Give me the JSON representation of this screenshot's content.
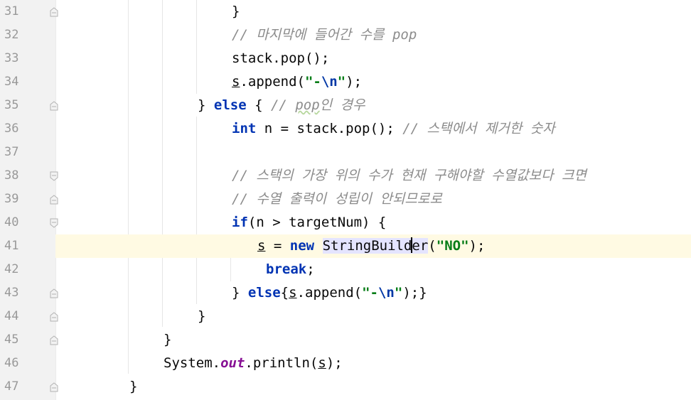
{
  "editor": {
    "current_line": "41",
    "lines": [
      {
        "num": "31",
        "code": "}"
      },
      {
        "num": "32",
        "comment": "// 마지막에 들어간 수를 pop"
      },
      {
        "num": "33",
        "code": "stack.pop();"
      },
      {
        "num": "34",
        "var": "s",
        "code": ".append(",
        "str_open": "\"-",
        "esc": "\\n",
        "str_close": "\"",
        "tail": ");"
      },
      {
        "num": "35",
        "brace": "} ",
        "kw": "else",
        "code": " { ",
        "comment_a": "// ",
        "comment_typo": "pop",
        "comment_b": "인 경우"
      },
      {
        "num": "36",
        "kw": "int",
        "code": " n = stack.pop(); ",
        "comment": "// 스택에서 제거한 숫자"
      },
      {
        "num": "37",
        "code": ""
      },
      {
        "num": "38",
        "comment": "// 스택의 가장 위의 수가 현재 구해야할 수열값보다 크면"
      },
      {
        "num": "39",
        "comment": "// 수열 출력이 성립이 안되므로로"
      },
      {
        "num": "40",
        "kw": "if",
        "code": "(n > targetNum) {"
      },
      {
        "num": "41",
        "var": "s",
        "code_a": " = ",
        "kw": "new",
        "code_b": " ",
        "hl_a": "StringBuild",
        "hl_b": "er",
        "code_c": "(",
        "str": "\"NO\"",
        "tail": ");"
      },
      {
        "num": "42",
        "kw": "break",
        "code": ";"
      },
      {
        "num": "43",
        "brace": "} ",
        "kw": "else",
        "code_a": "{",
        "var": "s",
        "code_b": ".append(",
        "str_open": "\"-",
        "esc": "\\n",
        "str_close": "\"",
        "tail": ");}"
      },
      {
        "num": "44",
        "code": "}"
      },
      {
        "num": "45",
        "code": "}"
      },
      {
        "num": "46",
        "code_a": "System.",
        "field": "out",
        "code_b": ".println(",
        "var": "s",
        "tail": ");"
      },
      {
        "num": "47",
        "code": "}"
      }
    ]
  }
}
